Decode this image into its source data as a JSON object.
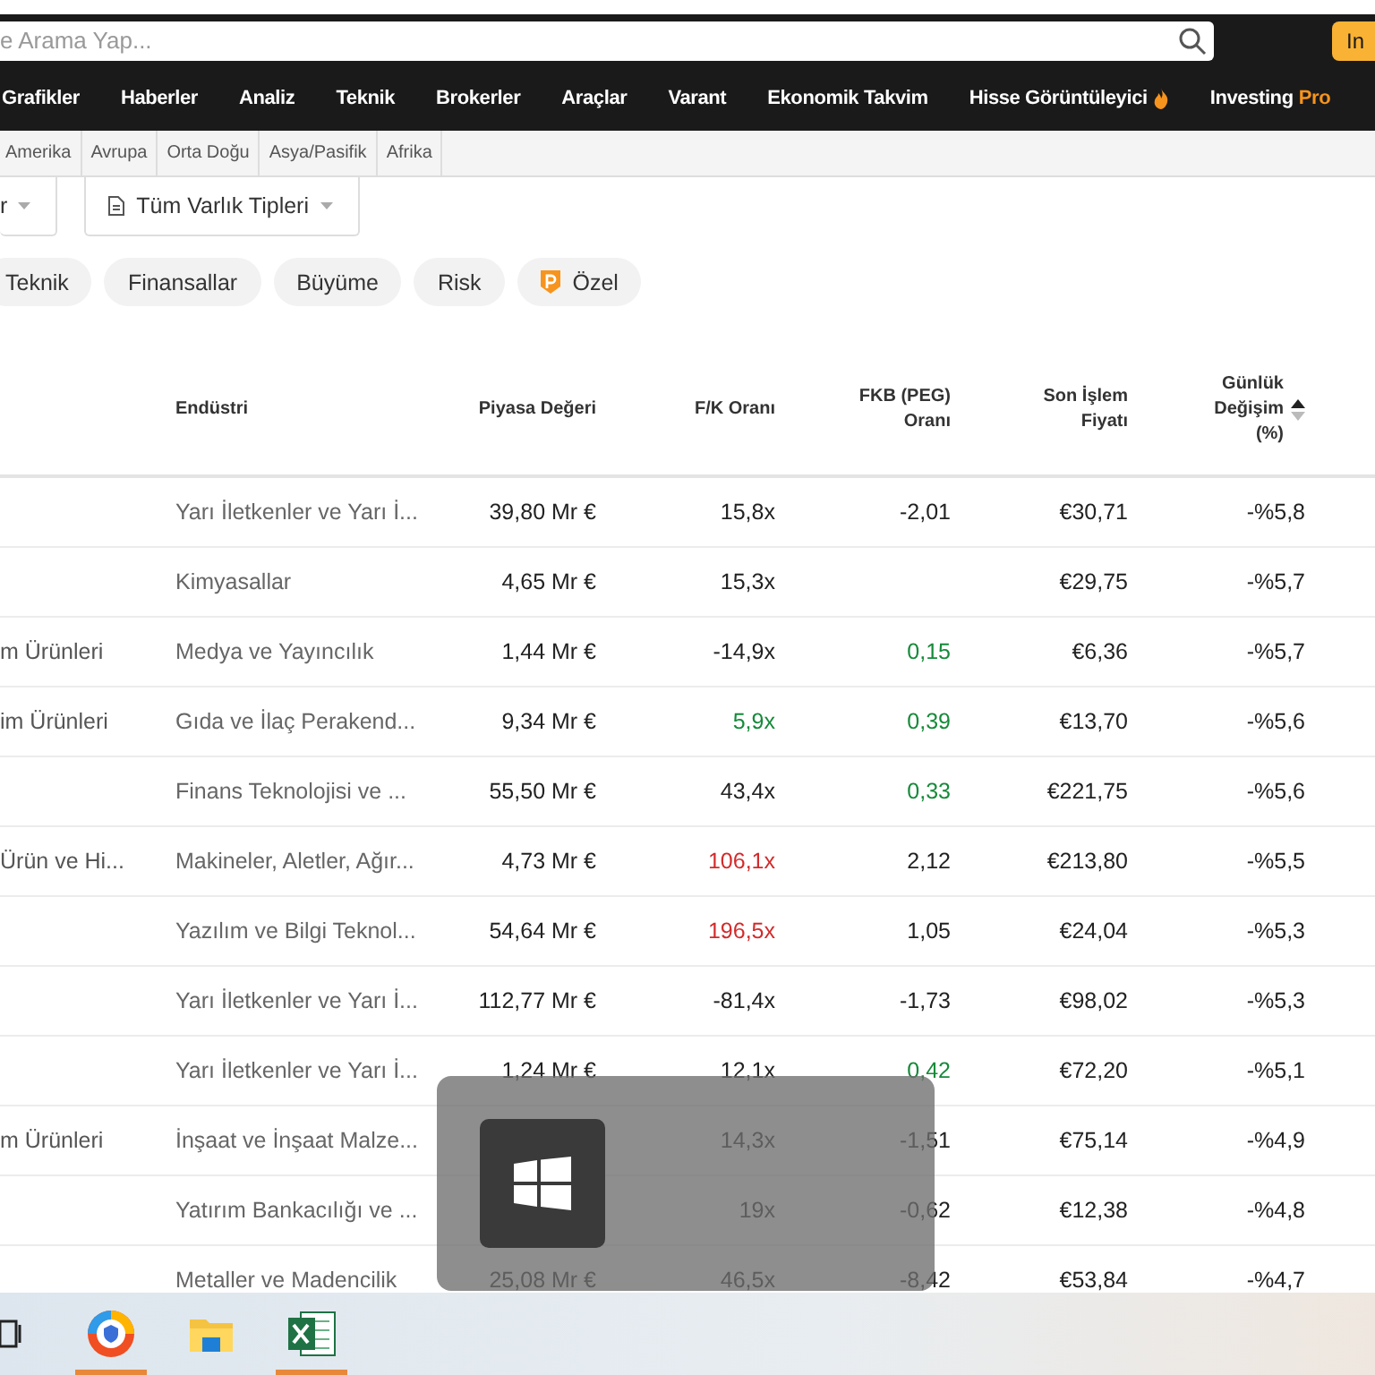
{
  "search": {
    "placeholder": "e Arama Yap..."
  },
  "header_button": {
    "label": "In"
  },
  "nav": [
    {
      "label": "Grafikler",
      "kind": "plain"
    },
    {
      "label": "Haberler",
      "kind": "plain"
    },
    {
      "label": "Analiz",
      "kind": "plain"
    },
    {
      "label": "Teknik",
      "kind": "plain"
    },
    {
      "label": "Brokerler",
      "kind": "plain"
    },
    {
      "label": "Araçlar",
      "kind": "plain"
    },
    {
      "label": "Varant",
      "kind": "plain"
    },
    {
      "label": "Ekonomik Takvim",
      "kind": "plain"
    },
    {
      "label": "Hisse Görüntüleyici",
      "kind": "hot"
    },
    {
      "label": "Investing",
      "suffix": "Pro",
      "kind": "pro"
    }
  ],
  "regions": [
    {
      "label": "Amerika",
      "selected": false
    },
    {
      "label": "Avrupa",
      "selected": false
    },
    {
      "label": "Orta Doğu",
      "selected": false
    },
    {
      "label": "Asya/Pasifik",
      "selected": false
    },
    {
      "label": "Afrika",
      "selected": false
    }
  ],
  "filters": [
    {
      "label": "r",
      "kind": "plain"
    },
    {
      "label": "Tüm Varlık Tipleri",
      "kind": "document"
    }
  ],
  "pills": [
    {
      "label": "Teknik",
      "kind": "plain"
    },
    {
      "label": "Finansallar",
      "kind": "plain"
    },
    {
      "label": "Büyüme",
      "kind": "plain"
    },
    {
      "label": "Risk",
      "kind": "plain"
    },
    {
      "label": "Özel",
      "kind": "pro"
    }
  ],
  "table": {
    "columns": [
      {
        "label": "Endüstri"
      },
      {
        "label": "Piyasa Değeri"
      },
      {
        "label": "F/K Oranı"
      },
      {
        "label": "FKB (PEG) Oranı"
      },
      {
        "label": "Son İşlem Fiyatı"
      },
      {
        "label": "Günlük Değişim (%)",
        "sorted": true
      }
    ],
    "rows": [
      {
        "industry": "Yarı İletkenler ve Yarı İ...",
        "market_cap": "39,80 Mr €",
        "pe": {
          "value": "15,8x"
        },
        "peg": {
          "value": "-2,01"
        },
        "price": "€30,71",
        "change": "-%5,8"
      },
      {
        "industry": "Kimyasallar",
        "market_cap": "4,65 Mr €",
        "pe": {
          "value": "15,3x"
        },
        "price": "€29,75",
        "change": "-%5,7"
      },
      {
        "sector": "m Ürünleri",
        "industry": "Medya ve Yayıncılık",
        "market_cap": "1,44 Mr €",
        "pe": {
          "value": "-14,9x"
        },
        "peg": {
          "value": "0,15",
          "color": "#168a3a"
        },
        "price": "€6,36",
        "change": "-%5,7"
      },
      {
        "sector": "im Ürünleri",
        "industry": "Gıda ve İlaç Perakend...",
        "market_cap": "9,34 Mr €",
        "pe": {
          "value": "5,9x",
          "color": "#168a3a"
        },
        "peg": {
          "value": "0,39",
          "color": "#168a3a"
        },
        "price": "€13,70",
        "change": "-%5,6"
      },
      {
        "industry": "Finans Teknolojisi ve ...",
        "market_cap": "55,50 Mr €",
        "pe": {
          "value": "43,4x"
        },
        "peg": {
          "value": "0,33",
          "color": "#168a3a"
        },
        "price": "€221,75",
        "change": "-%5,6"
      },
      {
        "sector": "Ürün ve Hi...",
        "industry": "Makineler, Aletler, Ağır...",
        "market_cap": "4,73 Mr €",
        "pe": {
          "value": "106,1x",
          "color": "#d22b2b"
        },
        "peg": {
          "value": "2,12"
        },
        "price": "€213,80",
        "change": "-%5,5"
      },
      {
        "industry": "Yazılım ve Bilgi Teknol...",
        "market_cap": "54,64 Mr €",
        "pe": {
          "value": "196,5x",
          "color": "#d22b2b"
        },
        "peg": {
          "value": "1,05"
        },
        "price": "€24,04",
        "change": "-%5,3"
      },
      {
        "industry": "Yarı İletkenler ve Yarı İ...",
        "market_cap": "112,77 Mr €",
        "pe": {
          "value": "-81,4x"
        },
        "peg": {
          "value": "-1,73"
        },
        "price": "€98,02",
        "change": "-%5,3"
      },
      {
        "industry": "Yarı İletkenler ve Yarı İ...",
        "market_cap": "1,24 Mr €",
        "pe": {
          "value": "12,1x"
        },
        "peg": {
          "value": "0,42",
          "color": "#168a3a"
        },
        "price": "€72,20",
        "change": "-%5,1"
      },
      {
        "sector": "m Ürünleri",
        "industry": "İnşaat ve İnşaat Malze...",
        "pe": {
          "value": "14,3x"
        },
        "peg": {
          "value": "-1,51"
        },
        "price": "€75,14",
        "change": "-%4,9"
      },
      {
        "industry": "Yatırım Bankacılığı ve ...",
        "pe": {
          "value": "19x"
        },
        "peg": {
          "value": "-0,62"
        },
        "price": "€12,38",
        "change": "-%4,8"
      },
      {
        "industry": "Metaller ve Madencilik",
        "market_cap": "25,08 Mr €",
        "pe": {
          "value": "46,5x"
        },
        "peg": {
          "value": "-8,42"
        },
        "price": "€53,84",
        "change": "-%4,7"
      }
    ]
  },
  "taskbar": [
    {
      "kind": "taskview",
      "active": false
    },
    {
      "kind": "browser",
      "active": true
    },
    {
      "kind": "folder",
      "active": false
    },
    {
      "kind": "spreadsheet",
      "active": true
    }
  ],
  "overlay": {
    "kind": "start-key"
  }
}
